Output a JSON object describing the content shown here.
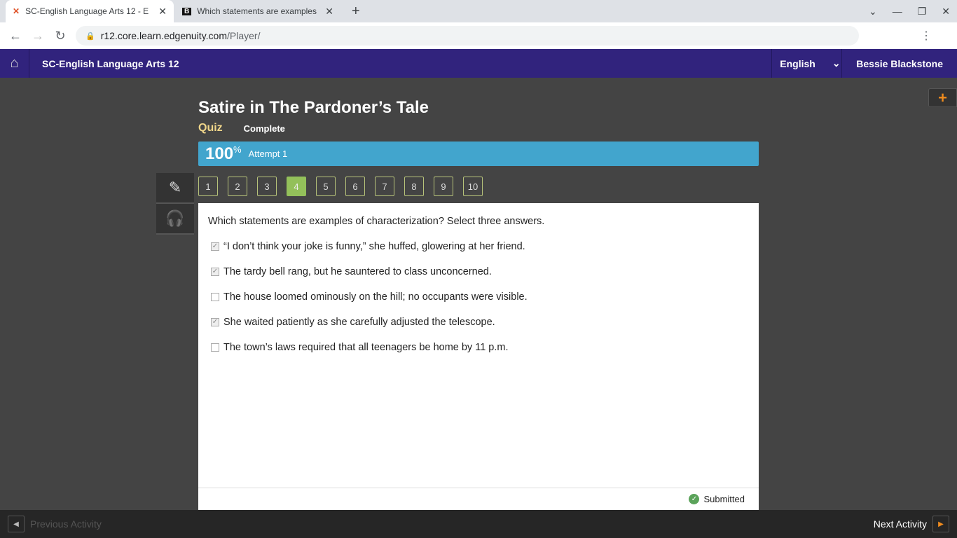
{
  "browser": {
    "tabs": [
      {
        "title": "SC-English Language Arts 12 - E"
      },
      {
        "title": "Which statements are examples"
      }
    ],
    "url_host": "r12.core.learn.edgenuity.com",
    "url_path": "/Player/"
  },
  "app": {
    "course": "SC-English Language Arts 12",
    "language": "English",
    "user": "Bessie Blackstone"
  },
  "activity": {
    "title": "Satire in The Pardoner’s Tale",
    "type": "Quiz",
    "status": "Complete",
    "score": "100",
    "score_unit": "%",
    "attempt": "Attempt 1"
  },
  "questions": [
    "1",
    "2",
    "3",
    "4",
    "5",
    "6",
    "7",
    "8",
    "9",
    "10"
  ],
  "current_question": "4",
  "question": {
    "prompt": "Which statements are examples of characterization? Select three answers.",
    "answers": [
      {
        "text": "“I don’t think your joke is funny,” she huffed, glowering at her friend.",
        "checked": true
      },
      {
        "text": "The tardy bell rang, but he sauntered to class unconcerned.",
        "checked": true
      },
      {
        "text": "The house loomed ominously on the hill; no occupants were visible.",
        "checked": false
      },
      {
        "text": "She waited patiently as she carefully adjusted the telescope.",
        "checked": true
      },
      {
        "text": "The town’s laws required that all teenagers be home by 11 p.m.",
        "checked": false
      }
    ]
  },
  "footer_status": "Submitted",
  "nav": {
    "previous": "Previous Activity",
    "next": "Next Activity"
  }
}
